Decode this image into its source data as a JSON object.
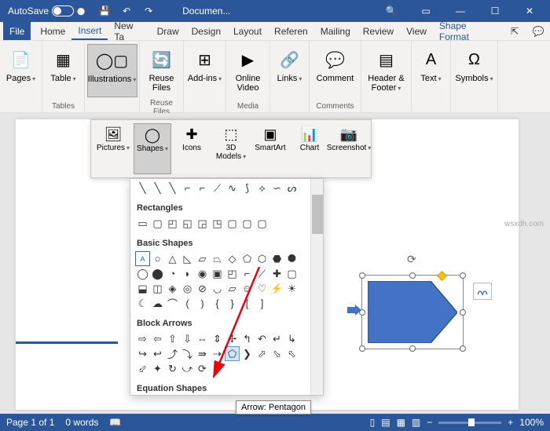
{
  "titlebar": {
    "autosave": "AutoSave",
    "off": "Off",
    "doc": "Documen..."
  },
  "tabs": {
    "file": "File",
    "home": "Home",
    "insert": "Insert",
    "newtab": "New Ta",
    "draw": "Draw",
    "design": "Design",
    "layout": "Layout",
    "refer": "Referen",
    "mail": "Mailing",
    "review": "Review",
    "view": "View",
    "format": "Shape Format"
  },
  "groups": {
    "pages": "Pages",
    "tables": "Tables",
    "illus": "Illustrations",
    "reuse": "Reuse Files",
    "addins": "",
    "media": "Media",
    "links": "",
    "comments": "Comments",
    "hf": "",
    "text": "",
    "symbols": ""
  },
  "btns": {
    "pages": "Pages",
    "table": "Table",
    "illus": "Illustrations",
    "reuse": "Reuse Files",
    "addins": "Add-ins",
    "video": "Online Video",
    "links": "Links",
    "comment": "Comment",
    "hf": "Header & Footer",
    "text": "Text",
    "symbols": "Symbols"
  },
  "sub": {
    "pictures": "Pictures",
    "shapes": "Shapes",
    "icons": "Icons",
    "models": "3D Models",
    "smartart": "SmartArt",
    "chart": "Chart",
    "screenshot": "Screenshot"
  },
  "panel": {
    "rectangles": "Rectangles",
    "basic": "Basic Shapes",
    "block": "Block Arrows",
    "equation": "Equation Shapes"
  },
  "tooltip": "Arrow: Pentagon",
  "status": {
    "page": "Page 1 of 1",
    "words": "0 words",
    "zoom": "100%"
  },
  "watermark": "wsxdh.com"
}
